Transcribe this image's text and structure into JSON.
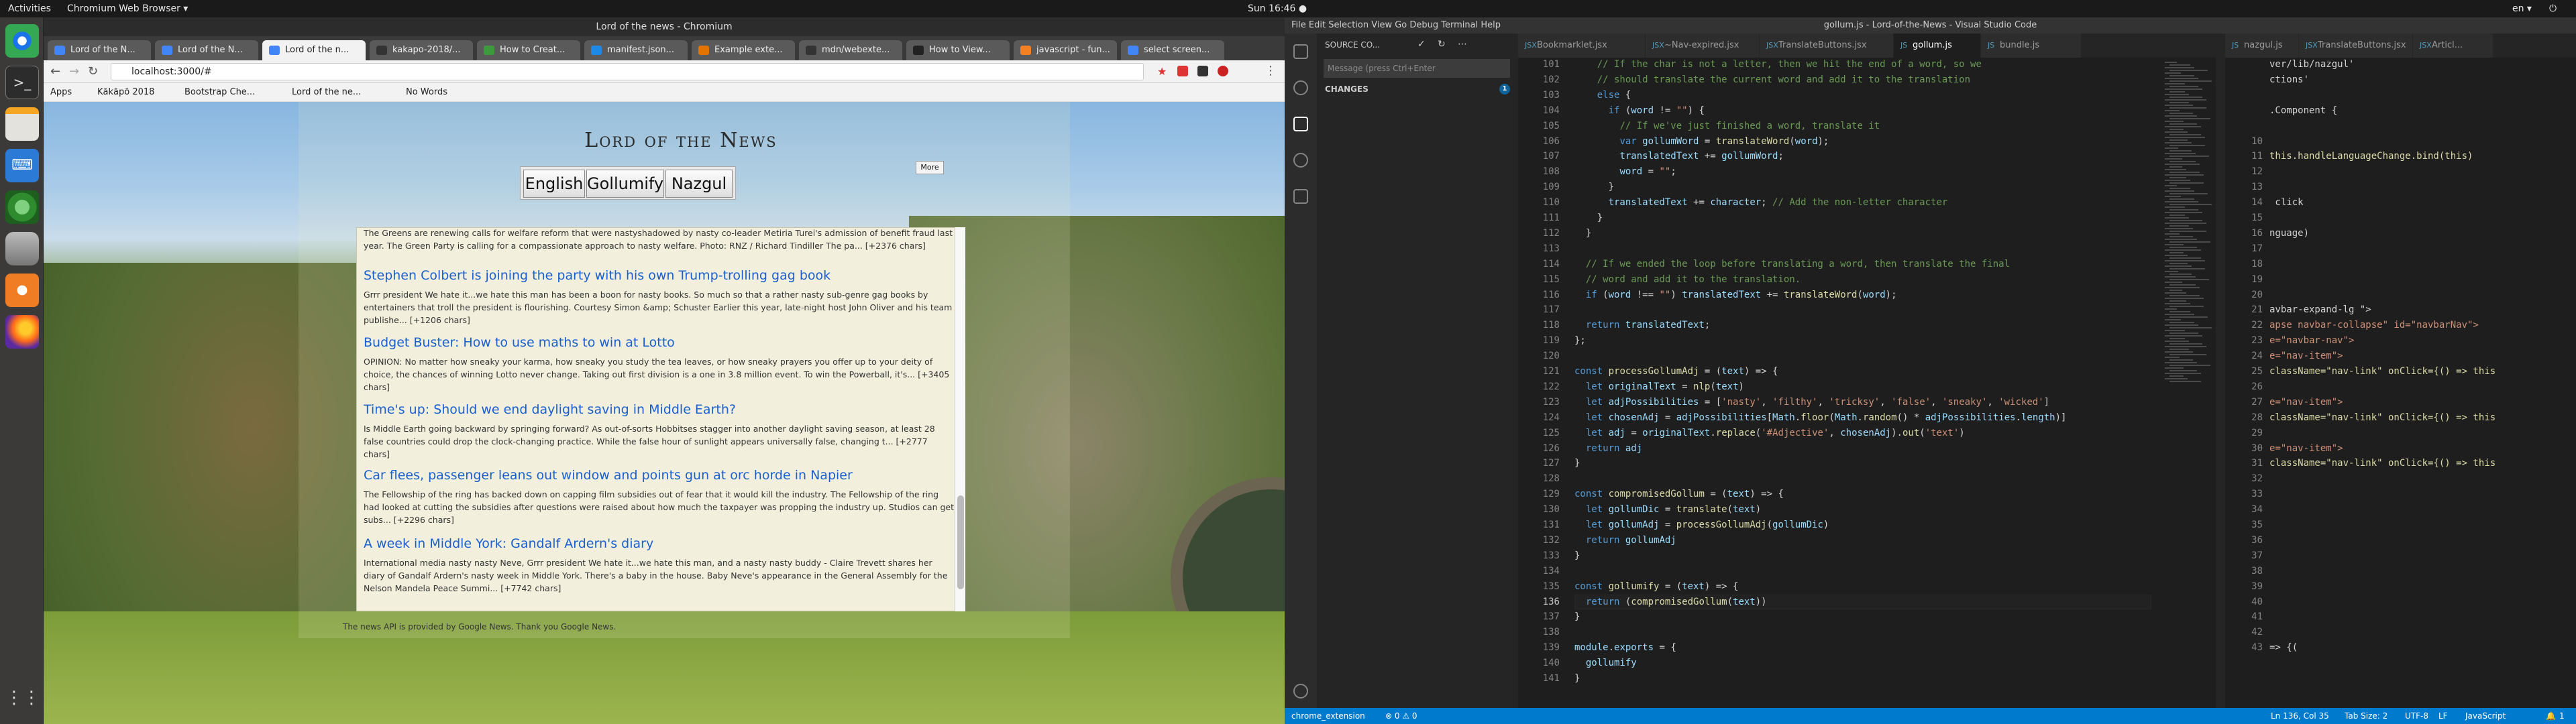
{
  "desktop": {
    "activities": "Activities",
    "app_menu": "Chromium Web Browser ▾",
    "clock": "Sun 16:46 ●",
    "lang": "en ▾"
  },
  "browser": {
    "window_title": "Lord of the news - Chromium",
    "tabs": [
      {
        "label": "Lord of the N...",
        "color": "#4285f4"
      },
      {
        "label": "Lord of the N...",
        "color": "#4285f4"
      },
      {
        "label": "Lord of the n...",
        "color": "#4285f4",
        "active": true
      },
      {
        "label": "kakapo-2018/...",
        "color": "#333333"
      },
      {
        "label": "How to Creat...",
        "color": "#3c9a3c"
      },
      {
        "label": "manifest.json...",
        "color": "#1e88e5"
      },
      {
        "label": "Example exte...",
        "color": "#e37400"
      },
      {
        "label": "mdn/webexte...",
        "color": "#333333"
      },
      {
        "label": "How to View...",
        "color": "#222222"
      },
      {
        "label": "javascript - fun...",
        "color": "#f48024"
      },
      {
        "label": "select screen...",
        "color": "#4285f4"
      }
    ],
    "url": "localhost:3000/#",
    "bookmarks": [
      "Apps",
      "Kākāpō 2018",
      "Bootstrap Che...",
      "Lord of the ne...",
      "No Words"
    ]
  },
  "site": {
    "title": "Lord of the News",
    "more_label": "More",
    "languages": [
      "English",
      "Gollumify",
      "Nazgul"
    ],
    "articles": [
      {
        "title": "",
        "body": "The Greens are renewing calls for welfare reform that were nastyshadowed by nasty co-leader Metiria Turei's admission of benefit fraud last year. The Green Party is calling for a compassionate approach to nasty welfare. Photo: RNZ / Richard Tindiller The pa... [+2376 chars]"
      },
      {
        "title": "Stephen Colbert is joining the party with his own Trump-trolling gag book",
        "body": "Grrr president We hate it...we hate this man has been a boon for nasty books. So much so that a rather nasty sub-genre gag books by entertainers that troll the president is flourishing. Courtesy Simon &amp; Schuster Earlier this year, late-night host John Oliver and his team publishe... [+1206 chars]"
      },
      {
        "title": "Budget Buster: How to use maths to win at Lotto",
        "body": "OPINION: No matter how sneaky your karma, how sneaky you study the tea leaves, or how sneaky prayers you offer up to your deity of choice, the chances of winning Lotto never change. Taking out first division is a one in 3.8 million event. To win the Powerball, it's... [+3405 chars]"
      },
      {
        "title": "Time's up: Should we end daylight saving in Middle Earth?",
        "body": "Is Middle Earth going backward by springing forward? As out-of-sorts Hobbitses stagger into another daylight saving season, at least 28 false countries could drop the clock-changing practice. While the false hour of sunlight appears universally false, changing t... [+2777 chars]"
      },
      {
        "title": "Car flees, passenger leans out window and points gun at orc horde in Napier",
        "body": "The Fellowship of the ring has backed down on capping film subsidies out of fear that it would kill the industry. The Fellowship of the ring had looked at cutting the subsidies after questions were raised about how much the taxpayer was propping the industry up. Studios can get subs... [+2296 chars]"
      },
      {
        "title": "A week in Middle York: Gandalf Ardern's diary",
        "body": "International media nasty nasty Neve, Grrr president We hate it...we hate this man, and a nasty nasty buddy - Claire Trevett shares her diary of Gandalf Ardern's nasty week in Middle York. There's a baby in the house. Baby Neve's appearance in the General Assembly for the Nelson Mandela Peace Summi... [+7742 chars]"
      }
    ],
    "footer": "The news API is provided by Google News. Thank you Google News."
  },
  "vscode": {
    "title": "gollum.js - Lord-of-the-News - Visual Studio Code",
    "menu": "File  Edit  Selection  View  Go  Debug  Terminal  Help",
    "sidebar_header": "SOURCE CO...",
    "commit_placeholder": "Message (press Ctrl+Enter",
    "changes_label": "CHANGES",
    "changes_count": "1",
    "tabs": [
      {
        "label": "Bookmarklet.jsx",
        "icon": "JSX"
      },
      {
        "label": "~Nav-expired.jsx",
        "icon": "JSX"
      },
      {
        "label": "TranslateButtons.jsx",
        "icon": "JSX"
      },
      {
        "label": "gollum.js",
        "icon": "JS",
        "active": true
      },
      {
        "label": "bundle.js",
        "icon": "JS"
      }
    ],
    "split_tabs": [
      {
        "label": "nazgul.js",
        "icon": "JS"
      },
      {
        "label": "TranslateButtons.jsx",
        "icon": "JSX"
      },
      {
        "label": "Articl...",
        "icon": "JSX"
      }
    ],
    "status": {
      "branch": "chrome_extension",
      "problems": "⊗ 0 ⚠ 0",
      "position": "Ln 136, Col 35",
      "tabsize": "Tab Size: 2",
      "encoding": "UTF-8",
      "eol": "LF",
      "language": "JavaScript",
      "badge": "1"
    },
    "split_lines": [
      {
        "n": "",
        "t": "ver/lib/nazgul'"
      },
      {
        "n": "",
        "t": "ctions'"
      },
      {
        "n": "",
        "t": ""
      },
      {
        "n": "",
        "t": ".Component {"
      },
      {
        "n": "",
        "t": ""
      },
      {
        "n": "10",
        "t": ""
      },
      {
        "n": "11",
        "t": "this.handleLanguageChange.bind(this)"
      },
      {
        "n": "12",
        "t": ""
      },
      {
        "n": "13",
        "t": ""
      },
      {
        "n": "14",
        "t": " click"
      },
      {
        "n": "15",
        "t": ""
      },
      {
        "n": "16",
        "t": "nguage)"
      },
      {
        "n": "17",
        "t": ""
      },
      {
        "n": "18",
        "t": ""
      },
      {
        "n": "19",
        "t": ""
      },
      {
        "n": "20",
        "t": ""
      },
      {
        "n": "21",
        "t": "avbar-expand-lg \">"
      },
      {
        "n": "22",
        "t": "apse navbar-collapse\" id=\"navbarNav\">"
      },
      {
        "n": "23",
        "t": "e=\"navbar-nav\">"
      },
      {
        "n": "24",
        "t": "e=\"nav-item\">"
      },
      {
        "n": "25",
        "t": "className=\"nav-link\" onClick={() => this"
      },
      {
        "n": "26",
        "t": ""
      },
      {
        "n": "27",
        "t": "e=\"nav-item\">"
      },
      {
        "n": "28",
        "t": "className=\"nav-link\" onClick={() => this"
      },
      {
        "n": "29",
        "t": ""
      },
      {
        "n": "30",
        "t": "e=\"nav-item\">"
      },
      {
        "n": "31",
        "t": "className=\"nav-link\" onClick={() => this"
      },
      {
        "n": "32",
        "t": ""
      },
      {
        "n": "33",
        "t": ""
      },
      {
        "n": "34",
        "t": ""
      },
      {
        "n": "35",
        "t": ""
      },
      {
        "n": "36",
        "t": ""
      },
      {
        "n": "37",
        "t": ""
      },
      {
        "n": "38",
        "t": ""
      },
      {
        "n": "39",
        "t": ""
      },
      {
        "n": "40",
        "t": ""
      },
      {
        "n": "41",
        "t": ""
      },
      {
        "n": "42",
        "t": ""
      },
      {
        "n": "43",
        "t": "=> {("
      }
    ]
  },
  "code_lines": [
    {
      "n": "101",
      "h": "    <span class=\"c\">// If the char is not a letter, then we hit the end of a word, so we</span>"
    },
    {
      "n": "102",
      "h": "    <span class=\"c\">// should translate the current word and add it to the translation</span>"
    },
    {
      "n": "103",
      "h": "    <span class=\"k\">else</span> {"
    },
    {
      "n": "104",
      "h": "      <span class=\"k\">if</span> (<span class=\"v\">word</span> != <span class=\"s\">\"\"</span>) {"
    },
    {
      "n": "105",
      "h": "        <span class=\"c\">// If we've just finished a word, translate it</span>"
    },
    {
      "n": "106",
      "h": "        <span class=\"k\">var</span> <span class=\"v\">gollumWord</span> = <span class=\"f\">translateWord</span>(<span class=\"v\">word</span>);"
    },
    {
      "n": "107",
      "h": "        <span class=\"v\">translatedText</span> += <span class=\"v\">gollumWord</span>;"
    },
    {
      "n": "108",
      "h": "        <span class=\"v\">word</span> = <span class=\"s\">\"\"</span>;"
    },
    {
      "n": "109",
      "h": "      }"
    },
    {
      "n": "110",
      "h": "      <span class=\"v\">translatedText</span> += <span class=\"v\">character</span>; <span class=\"c\">// Add the non-letter character</span>"
    },
    {
      "n": "111",
      "h": "    }"
    },
    {
      "n": "112",
      "h": "  }"
    },
    {
      "n": "113",
      "h": ""
    },
    {
      "n": "114",
      "h": "  <span class=\"c\">// If we ended the loop before translating a word, then translate the final</span>"
    },
    {
      "n": "115",
      "h": "  <span class=\"c\">// word and add it to the translation.</span>"
    },
    {
      "n": "116",
      "h": "  <span class=\"k\">if</span> (<span class=\"v\">word</span> !== <span class=\"s\">\"\"</span>) <span class=\"v\">translatedText</span> += <span class=\"f\">translateWord</span>(<span class=\"v\">word</span>);"
    },
    {
      "n": "117",
      "h": ""
    },
    {
      "n": "118",
      "h": "  <span class=\"k\">return</span> <span class=\"v\">translatedText</span>;"
    },
    {
      "n": "119",
      "h": "};"
    },
    {
      "n": "120",
      "h": ""
    },
    {
      "n": "121",
      "h": "<span class=\"k\">const</span> <span class=\"f\">processGollumAdj</span> = (<span class=\"v\">text</span>) => {"
    },
    {
      "n": "122",
      "h": "  <span class=\"k\">let</span> <span class=\"v\">originalText</span> = <span class=\"f\">nlp</span>(<span class=\"v\">text</span>)"
    },
    {
      "n": "123",
      "h": "  <span class=\"k\">let</span> <span class=\"v\">adjPossibilities</span> = [<span class=\"s\">'nasty'</span>, <span class=\"s\">'filthy'</span>, <span class=\"s\">'tricksy'</span>, <span class=\"s\">'false'</span>, <span class=\"s\">'sneaky'</span>, <span class=\"s\">'wicked'</span>]"
    },
    {
      "n": "124",
      "h": "  <span class=\"k\">let</span> <span class=\"v\">chosenAdj</span> = <span class=\"v\">adjPossibilities</span>[<span class=\"v\">Math</span>.<span class=\"f\">floor</span>(<span class=\"v\">Math</span>.<span class=\"f\">random</span>() * <span class=\"v\">adjPossibilities</span>.<span class=\"v\">length</span>)]"
    },
    {
      "n": "125",
      "h": "  <span class=\"k\">let</span> <span class=\"v\">adj</span> = <span class=\"v\">originalText</span>.<span class=\"f\">replace</span>(<span class=\"s\">'#Adjective'</span>, <span class=\"v\">chosenAdj</span>).<span class=\"f\">out</span>(<span class=\"s\">'text'</span>)"
    },
    {
      "n": "126",
      "h": "  <span class=\"k\">return</span> <span class=\"v\">adj</span>"
    },
    {
      "n": "127",
      "h": "}"
    },
    {
      "n": "128",
      "h": ""
    },
    {
      "n": "129",
      "h": "<span class=\"k\">const</span> <span class=\"f\">compromisedGollum</span> = (<span class=\"v\">text</span>) => {"
    },
    {
      "n": "130",
      "h": "  <span class=\"k\">let</span> <span class=\"v\">gollumDic</span> = <span class=\"f\">translate</span>(<span class=\"v\">text</span>)"
    },
    {
      "n": "131",
      "h": "  <span class=\"k\">let</span> <span class=\"v\">gollumAdj</span> = <span class=\"f\">processGollumAdj</span>(<span class=\"v\">gollumDic</span>)"
    },
    {
      "n": "132",
      "h": "  <span class=\"k\">return</span> <span class=\"v\">gollumAdj</span>"
    },
    {
      "n": "133",
      "h": "}"
    },
    {
      "n": "134",
      "h": ""
    },
    {
      "n": "135",
      "h": "<span class=\"k\">const</span> <span class=\"f\">gollumify</span> = (<span class=\"v\">text</span>) => {"
    },
    {
      "n": "136",
      "h": "  <span class=\"k\">return</span> (<span class=\"f\">compromisedGollum</span>(<span class=\"v\">text</span>))"
    },
    {
      "n": "137",
      "h": "}"
    },
    {
      "n": "138",
      "h": ""
    },
    {
      "n": "139",
      "h": "<span class=\"v\">module</span>.<span class=\"v\">exports</span> = {"
    },
    {
      "n": "140",
      "h": "  <span class=\"v\">gollumify</span>"
    },
    {
      "n": "141",
      "h": "}"
    }
  ],
  "current_line": "136"
}
